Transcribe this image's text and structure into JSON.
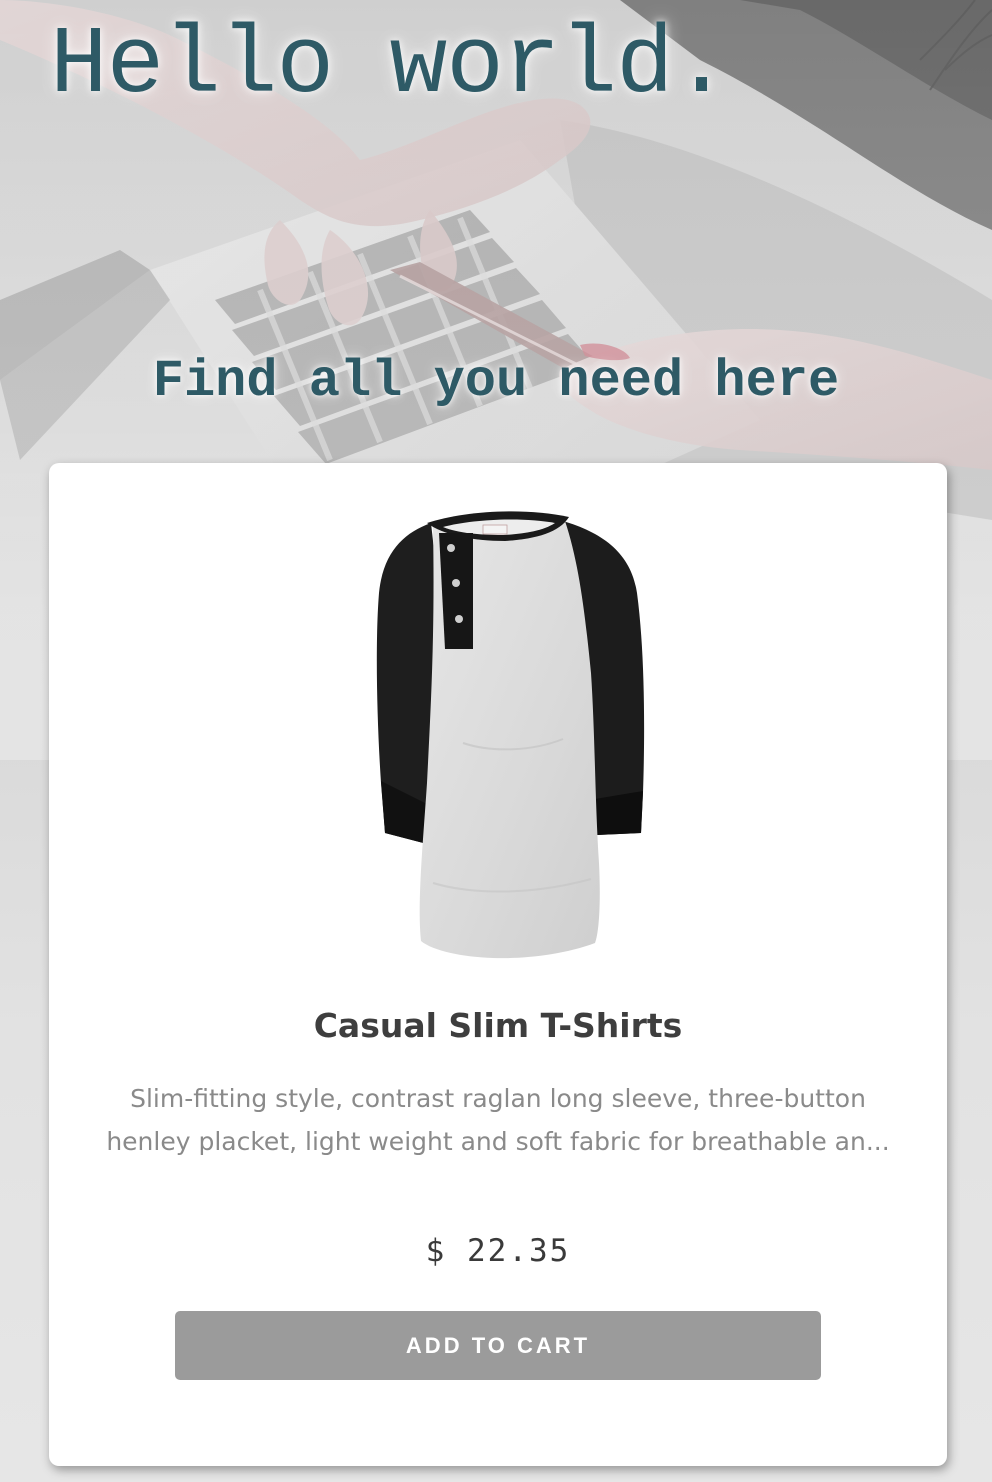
{
  "hero": {
    "title": "Hello world.",
    "subtitle": "Find all you need here",
    "background": "hands-typing-laptop-credit-card-photo"
  },
  "product": {
    "image": "raglan-henley-shirt-image",
    "name": "Casual Slim T-Shirts",
    "description": "Slim-fitting style, contrast raglan long sleeve, three-button henley placket, light weight and soft fabric for breathable an...",
    "price": "$ 22.35",
    "add_to_cart_label": "Add to cart"
  },
  "colors": {
    "hero_text": "#2e5a66",
    "button_bg": "#9b9b9b",
    "card_bg": "#ffffff"
  }
}
